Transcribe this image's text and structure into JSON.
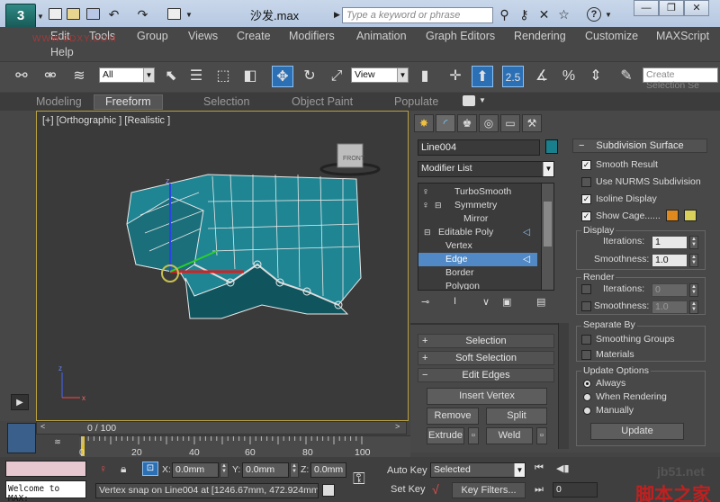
{
  "title_bar": {
    "file_title": "沙发.max",
    "search_placeholder": "Type a keyword or phrase",
    "help_label": "?",
    "window_minimize": "—",
    "window_restore": "❐",
    "window_close": "✕"
  },
  "app_logo": "3",
  "watermark_left": "WWW.3DXY.COM",
  "menu": [
    "Edit",
    "Tools",
    "Group",
    "Views",
    "Create",
    "Modifiers",
    "Animation",
    "Graph Editors",
    "Rendering",
    "Customize",
    "MAXScript",
    "Help"
  ],
  "toolbar": {
    "selection_filter": "All",
    "view_dropdown": "View",
    "snap_label": "2.5",
    "percent_label": "%",
    "named_selection_placeholder": "Create Selection Se"
  },
  "ribbon_tabs": [
    "Modeling",
    "Freeform",
    "Selection",
    "Object Paint",
    "Populate"
  ],
  "ribbon_active": "Freeform",
  "viewport": {
    "label": "[+] [Orthographic ] [Realistic ]",
    "viewcube_label": "FRONT"
  },
  "command_panel": {
    "object_name": "Line004",
    "object_color": "#1a7f8c",
    "modifier_list_label": "Modifier List",
    "stack": [
      {
        "label": "TurboSmooth",
        "level": 0,
        "icon": "bulb-icon"
      },
      {
        "label": "Symmetry",
        "level": 0,
        "icon": "bulb-icon"
      },
      {
        "label": "Mirror",
        "level": 1,
        "icon": ""
      },
      {
        "label": "Editable Poly",
        "level": 0,
        "icon": ""
      },
      {
        "label": "Vertex",
        "level": 1,
        "icon": ""
      },
      {
        "label": "Edge",
        "level": 1,
        "icon": "",
        "selected": true
      },
      {
        "label": "Border",
        "level": 1,
        "icon": ""
      },
      {
        "label": "Polygon",
        "level": 1,
        "icon": ""
      }
    ],
    "rollouts": {
      "selection": "Selection",
      "soft_selection": "Soft Selection",
      "edit_edges": "Edit Edges",
      "rollout_collapsed_marker": "+",
      "rollout_expanded_marker": "−"
    },
    "edit_edges_buttons": {
      "insert_vertex": "Insert Vertex",
      "remove": "Remove",
      "split": "Split",
      "extrude": "Extrude",
      "weld": "Weld"
    }
  },
  "subdivision": {
    "header": "Subdivision Surface",
    "smooth_result": "Smooth Result",
    "use_nurms": "Use NURMS Subdivision",
    "isoline_display": "Isoline Display",
    "show_cage": "Show Cage......",
    "cage_color_1": "#e08a1e",
    "cage_color_2": "#d8d05a",
    "display_group": "Display",
    "iterations_label": "Iterations:",
    "iterations_value": "1",
    "smoothness_label": "Smoothness:",
    "smoothness_value": "1.0",
    "render_group": "Render",
    "render_iterations_value": "0",
    "render_smoothness_value": "1.0",
    "separate_by_group": "Separate By",
    "smoothing_groups": "Smoothing Groups",
    "materials": "Materials",
    "update_options_group": "Update Options",
    "always": "Always",
    "when_rendering": "When Rendering",
    "manually": "Manually",
    "update_button": "Update"
  },
  "timeline": {
    "frame_display": "0 / 100",
    "ticks": [
      "0",
      "20",
      "40",
      "60",
      "80",
      "100"
    ]
  },
  "status_bar": {
    "script_listener": "Welcome to MAX:",
    "status_text": "Vertex snap on Line004 at [1246.67mm, 472.924mm,",
    "x_label": "X:",
    "x_value": "0.0mm",
    "y_label": "Y:",
    "y_value": "0.0mm",
    "z_label": "Z:",
    "z_value": "0.0mm",
    "auto_key": "Auto Key",
    "set_key": "Set Key",
    "key_mode": "Selected",
    "key_filters": "Key Filters...",
    "frame_field": "0"
  },
  "watermark_right": {
    "site": "jb51.net",
    "brand": "脚本之家"
  }
}
